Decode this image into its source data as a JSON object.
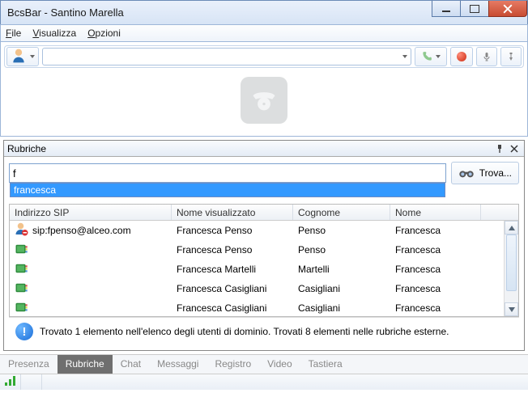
{
  "window": {
    "title": "BcsBar - Santino Marella"
  },
  "menu": {
    "file": "File",
    "view": "Visualizza",
    "options": "Opzioni"
  },
  "toolbar": {
    "presence_icon": "user-presence-icon",
    "combo_value": "",
    "call_icon": "phone-icon",
    "rec_icon": "record-icon",
    "mic_icon": "microphone-icon",
    "flag_icon": "pushpin-icon"
  },
  "panel": {
    "title": "Rubriche",
    "search_value": "f",
    "suggestion": "francesca",
    "find_label": "Trova..."
  },
  "table": {
    "cols": {
      "sip": "Indirizzo SIP",
      "display": "Nome visualizzato",
      "surname": "Cognome",
      "name": "Nome"
    },
    "rows": [
      {
        "icon": "user",
        "sip": "sip:fpenso@alceo.com",
        "display": "Francesca Penso",
        "surname": "Penso",
        "name": "Francesca"
      },
      {
        "icon": "book",
        "sip": "",
        "display": "Francesca Penso",
        "surname": "Penso",
        "name": "Francesca"
      },
      {
        "icon": "book",
        "sip": "",
        "display": "Francesca Martelli",
        "surname": "Martelli",
        "name": "Francesca"
      },
      {
        "icon": "book",
        "sip": "",
        "display": "Francesca Casigliani",
        "surname": "Casigliani",
        "name": "Francesca"
      },
      {
        "icon": "book",
        "sip": "",
        "display": "Francesca Casigliani",
        "surname": "Casigliani",
        "name": "Francesca"
      }
    ]
  },
  "status_msg": "Trovato 1 elemento nell'elenco degli utenti di dominio. Trovati 8 elementi nelle rubriche esterne.",
  "tabs": {
    "presenza": "Presenza",
    "rubriche": "Rubriche",
    "chat": "Chat",
    "messaggi": "Messaggi",
    "registro": "Registro",
    "video": "Video",
    "tastiera": "Tastiera"
  }
}
